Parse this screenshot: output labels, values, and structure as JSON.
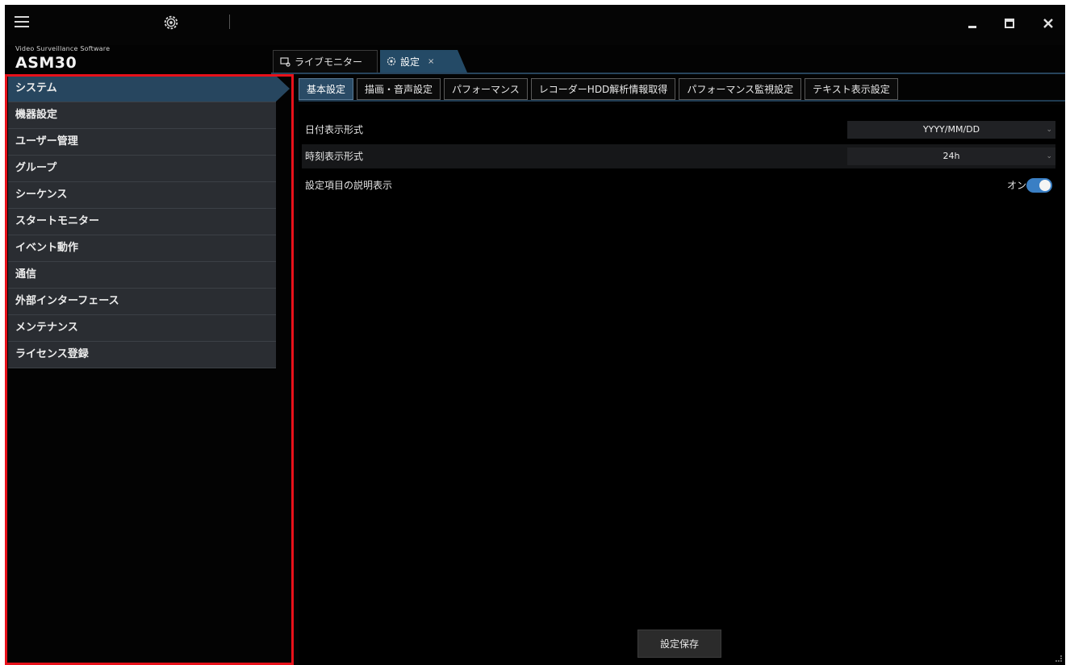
{
  "app": {
    "subtitle": "Video Surveillance Software",
    "name": "ASM30"
  },
  "top_tabs": [
    {
      "label": "ライブモニター",
      "icon": "monitor-icon"
    },
    {
      "label": "設定",
      "icon": "gear-icon",
      "close": "×"
    }
  ],
  "sidebar": {
    "items": [
      {
        "label": "システム",
        "active": true
      },
      {
        "label": "機器設定"
      },
      {
        "label": "ユーザー管理"
      },
      {
        "label": "グループ"
      },
      {
        "label": "シーケンス"
      },
      {
        "label": "スタートモニター"
      },
      {
        "label": "イベント動作"
      },
      {
        "label": "通信"
      },
      {
        "label": "外部インターフェース"
      },
      {
        "label": "メンテナンス"
      },
      {
        "label": "ライセンス登録"
      }
    ]
  },
  "sub_tabs": [
    {
      "label": "基本設定",
      "active": true
    },
    {
      "label": "描画・音声設定"
    },
    {
      "label": "パフォーマンス"
    },
    {
      "label": "レコーダーHDD解析情報取得"
    },
    {
      "label": "パフォーマンス監視設定"
    },
    {
      "label": "テキスト表示設定"
    }
  ],
  "settings": {
    "date_format_label": "日付表示形式",
    "date_format_value": "YYYY/MM/DD",
    "time_format_label": "時刻表示形式",
    "time_format_value": "24h",
    "help_display_label": "設定項目の説明表示",
    "help_display_state": "オン"
  },
  "save_label": "設定保存",
  "colors": {
    "accent": "#27465f",
    "highlight_box": "#e8111a",
    "toggle_on": "#3a7fc4"
  }
}
